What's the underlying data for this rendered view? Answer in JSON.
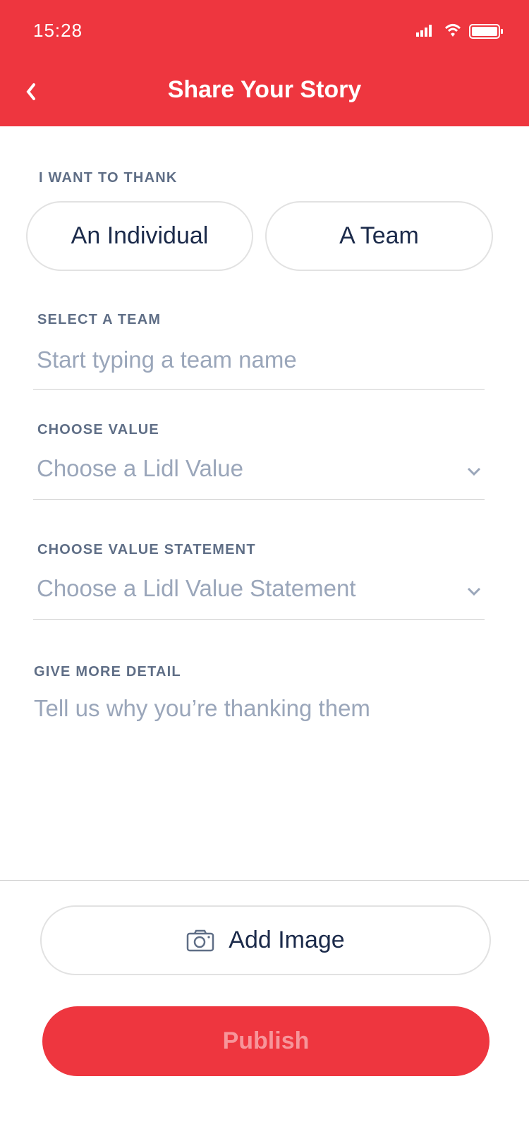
{
  "status_bar": {
    "time": "15:28"
  },
  "header": {
    "title": "Share Your Story"
  },
  "thank": {
    "label": "I WANT TO THANK",
    "options": [
      "An Individual",
      "A Team"
    ]
  },
  "team": {
    "label": "SELECT A TEAM",
    "placeholder": "Start typing a team name"
  },
  "value": {
    "label": "CHOOSE VALUE",
    "placeholder": "Choose a Lidl Value"
  },
  "statement": {
    "label": "CHOOSE VALUE STATEMENT",
    "placeholder": "Choose a Lidl Value Statement"
  },
  "detail": {
    "label": "GIVE MORE DETAIL",
    "placeholder": "Tell us why you’re thanking them"
  },
  "actions": {
    "add_image": "Add Image",
    "publish": "Publish"
  },
  "colors": {
    "brand": "#EE363F",
    "label": "#5F6E86",
    "text": "#1B2A4A",
    "placeholder": "#9AA6BA"
  }
}
